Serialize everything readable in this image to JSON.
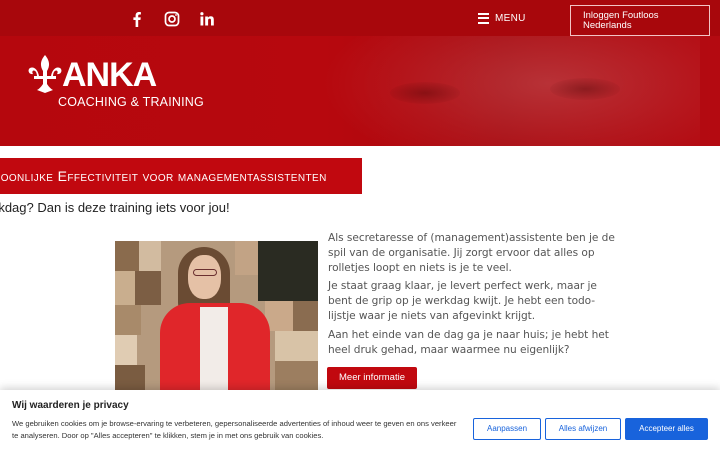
{
  "header": {
    "social": [
      {
        "name": "facebook-icon"
      },
      {
        "name": "instagram-icon"
      },
      {
        "name": "linkedin-icon"
      }
    ],
    "menu_label": "MENU",
    "login_label_line1": "Inloggen Foutloos",
    "login_label_line2": "Nederlands"
  },
  "logo": {
    "name": "ANKA",
    "tagline": "COACHING & TRAINING"
  },
  "main": {
    "title": "rsoonlijke Effectiviteit voor managementassistenten",
    "subtitle": "rkdag? Dan is deze training iets voor jou!",
    "paragraphs": [
      "Als secretaresse of (management)assistente ben je de spil van de organisatie. Jij zorgt ervoor dat alles op rolletjes loopt en niets is je te veel.",
      "Je staat graag klaar, je levert perfect werk, maar je bent de grip op je werkdag kwijt. Je hebt een todo-lijstje waar je niets van afgevinkt krijgt.",
      "Aan het einde van de dag ga je naar huis; je hebt het heel druk gehad, maar waarmee nu eigenlijk?"
    ],
    "more_button": "Meer informatie"
  },
  "cookie": {
    "title": "Wij waarderen je privacy",
    "text": "We gebruiken cookies om je browse-ervaring te verbeteren, gepersonaliseerde advertenties of inhoud weer te geven en ons verkeer te analyseren. Door op \"Alles accepteren\" te klikken, stem je in met ons gebruik van cookies.",
    "customize": "Aanpassen",
    "reject": "Alles afwijzen",
    "accept": "Accepteer alles"
  },
  "colors": {
    "brand_red": "#c1080f",
    "cookie_blue": "#1863dc"
  }
}
